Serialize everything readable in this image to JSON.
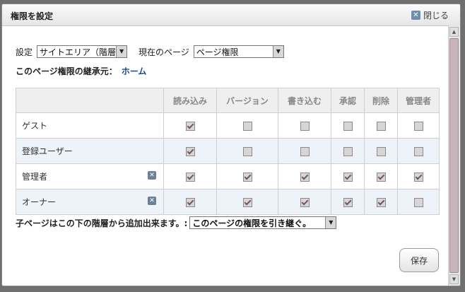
{
  "dialog": {
    "title": "権限を設定",
    "close_label": "閉じる"
  },
  "settings": {
    "setting_label": "設定",
    "setting_value": "サイトエリア（階層",
    "current_page_label": "現在のページ",
    "current_page_value": "ページ権限",
    "inherit_label": "このページ権限の継承元：",
    "inherit_link": "ホーム"
  },
  "table": {
    "columns": [
      "読み込み",
      "バージョン",
      "書き込む",
      "承認",
      "削除",
      "管理者"
    ],
    "rows": [
      {
        "role": "ゲスト",
        "removable": false,
        "checks": [
          true,
          false,
          false,
          false,
          false,
          false
        ]
      },
      {
        "role": "登録ユーザー",
        "removable": false,
        "checks": [
          true,
          false,
          false,
          false,
          false,
          false
        ]
      },
      {
        "role": "管理者",
        "removable": true,
        "checks": [
          true,
          true,
          true,
          true,
          true,
          true
        ]
      },
      {
        "role": "オーナー",
        "removable": true,
        "checks": [
          true,
          true,
          true,
          true,
          true,
          false
        ]
      }
    ]
  },
  "subpage": {
    "label": "子ページはこの下の階層から追加出来ます。:",
    "value": "このページの権限を引き継ぐ。"
  },
  "save_label": "保存"
}
